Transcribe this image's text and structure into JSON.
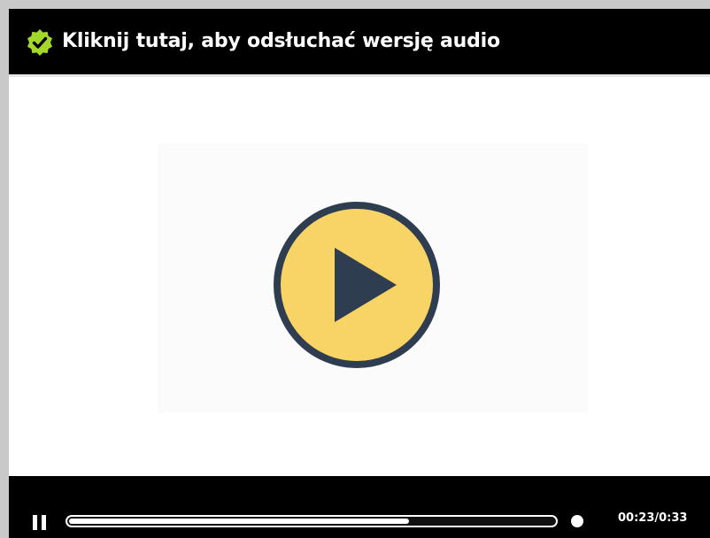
{
  "header": {
    "title": "Kliknij tutaj, aby odsłuchać wersję audio",
    "badge_icon": "verified-check-icon",
    "badge_color": "#a3d82b"
  },
  "player": {
    "play_icon": "play-icon",
    "play_circle_color": "#f8d365",
    "play_stroke_color": "#2e3d4f",
    "pause_icon": "pause-icon",
    "progress_fraction": 0.7,
    "time_display": "00:23/0:33",
    "volume_icon": "volume-knob-icon"
  }
}
